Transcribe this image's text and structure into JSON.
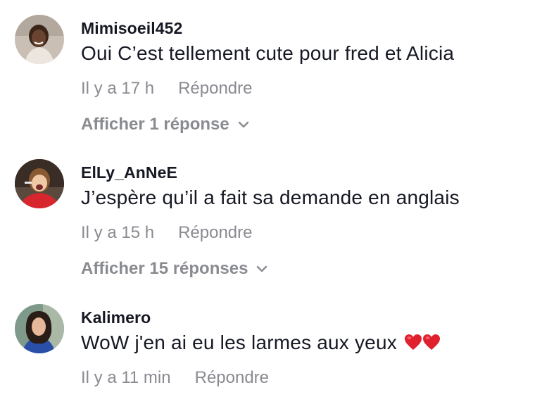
{
  "comments": [
    {
      "username": "Mimisoeil452",
      "text": "Oui C’est tellement cute pour fred et Alicia",
      "time": "Il y a 17 h",
      "reply_label": "Répondre",
      "replies_label": "Afficher 1 réponse",
      "hearts": 0
    },
    {
      "username": "ElLy_AnNeE",
      "text": "J’espère qu’il a fait sa demande en anglais",
      "time": "Il y a 15 h",
      "reply_label": "Répondre",
      "replies_label": "Afficher 15 réponses",
      "hearts": 0
    },
    {
      "username": "Kalimero",
      "text": "WoW j'en ai eu les larmes aux yeux",
      "time": "Il y a 11 min",
      "reply_label": "Répondre",
      "hearts": 2
    }
  ],
  "icons": {
    "chevron": "chevron-down-icon",
    "heart": "red-heart-emoji"
  },
  "colors": {
    "primary_text": "#161823",
    "secondary_text": "#8a8b91",
    "heart": "#e0202c"
  }
}
